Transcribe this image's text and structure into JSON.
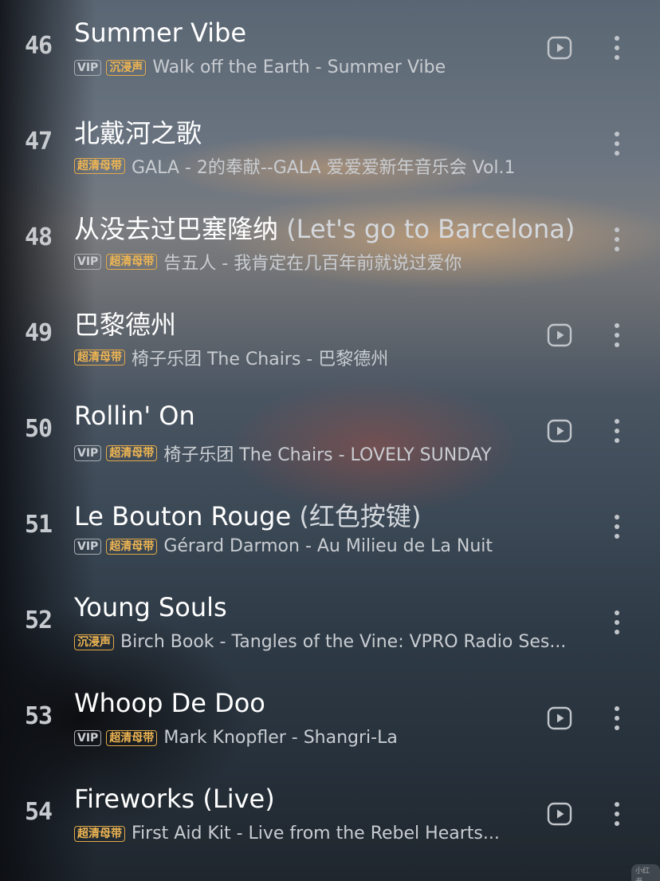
{
  "songs": [
    {
      "index": "46",
      "title": "Summer Vibe",
      "subtitle": "",
      "badges": [
        "VIP",
        "沉浸声"
      ],
      "meta": "Walk off the Earth - Summer Vibe",
      "has_video": true
    },
    {
      "index": "47",
      "title": "北戴河之歌",
      "subtitle": "",
      "badges": [
        "超清母带"
      ],
      "meta": "GALA - 2的奉献--GALA 爱爱爱新年音乐会 Vol.1",
      "has_video": false
    },
    {
      "index": "48",
      "title": "从没去过巴塞隆纳",
      "subtitle": "(Let's go to Barcelona)",
      "badges": [
        "VIP",
        "超清母带"
      ],
      "meta": "告五人 - 我肯定在几百年前就说过爱你",
      "has_video": false
    },
    {
      "index": "49",
      "title": "巴黎德州",
      "subtitle": "",
      "badges": [
        "超清母带"
      ],
      "meta": "椅子乐团 The Chairs - 巴黎德州",
      "has_video": true
    },
    {
      "index": "50",
      "title": "Rollin' On",
      "subtitle": "",
      "badges": [
        "VIP",
        "超清母带"
      ],
      "meta": "椅子乐团 The Chairs - LOVELY SUNDAY",
      "has_video": true
    },
    {
      "index": "51",
      "title": "Le Bouton Rouge",
      "subtitle": "(红色按键)",
      "badges": [
        "VIP",
        "超清母带"
      ],
      "meta": "Gérard Darmon - Au Milieu de La Nuit",
      "has_video": false
    },
    {
      "index": "52",
      "title": "Young Souls",
      "subtitle": "",
      "badges": [
        "沉浸声"
      ],
      "meta": "Birch Book - Tangles of the Vine: VPRO Radio Ses...",
      "has_video": false
    },
    {
      "index": "53",
      "title": "Whoop De Doo",
      "subtitle": "",
      "badges": [
        "VIP",
        "超清母带"
      ],
      "meta": "Mark Knopfler - Shangri-La",
      "has_video": true
    },
    {
      "index": "54",
      "title": "Fireworks (Live)",
      "subtitle": "",
      "badges": [
        "超清母带"
      ],
      "meta": "First Aid Kit - Live from the Rebel Hearts...",
      "has_video": true
    }
  ],
  "icons": {
    "video": "play-video-icon",
    "more": "more-vertical-icon"
  },
  "colors": {
    "badge_gold": "#f0b652",
    "badge_vip": "#c9cdd2",
    "title": "#ffffff",
    "meta": "#c9cdd2"
  }
}
